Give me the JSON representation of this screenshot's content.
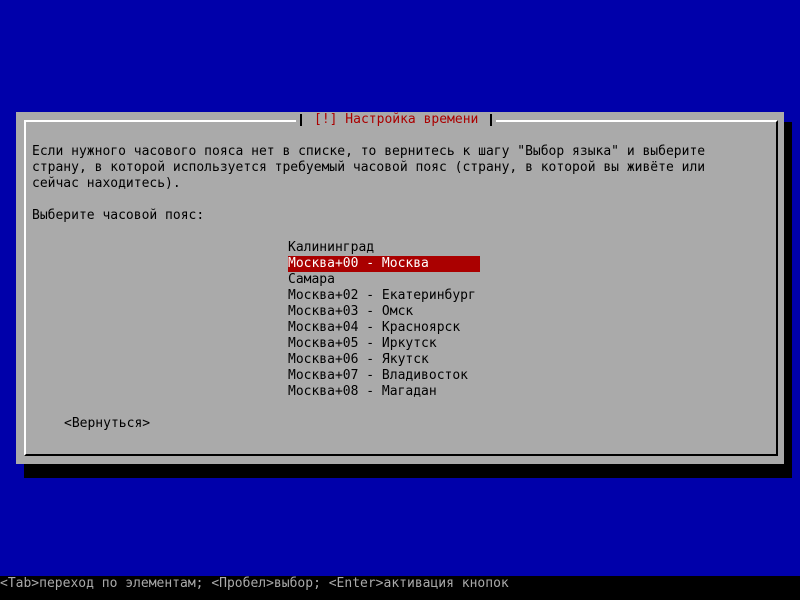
{
  "dialog": {
    "title": "[!] Настройка времени",
    "description": "Если нужного часового пояса нет в списке, то вернитесь к шагу \"Выбор языка\" и выберите\nстрану, в которой используется требуемый часовой пояс (страну, в которой вы живёте или\nсейчас находитесь).",
    "prompt": "Выберите часовой пояс:",
    "timezones": [
      "Калининград",
      "Москва+00 - Москва",
      "Самара",
      "Москва+02 - Екатеринбург",
      "Москва+03 - Омск",
      "Москва+04 - Красноярск",
      "Москва+05 - Иркутск",
      "Москва+06 - Якутск",
      "Москва+07 - Владивосток",
      "Москва+08 - Магадан"
    ],
    "selected_timezone": "Москва+00 - Москва",
    "back_button_label": "<Вернуться>"
  },
  "status_bar": {
    "text": "<Tab>переход по элементам; <Пробел>выбор; <Enter>активация кнопок"
  },
  "colors": {
    "background": "#0000aa",
    "dialog": "#aaaaaa",
    "accent": "#aa0000",
    "shadow": "#000000"
  }
}
